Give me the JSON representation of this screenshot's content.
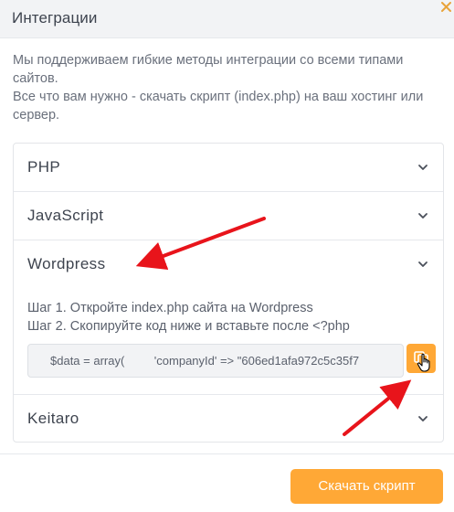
{
  "header": {
    "title": "Интеграции"
  },
  "description": {
    "line1": "Мы поддерживаем гибкие методы интеграции со всеми типами сайтов.",
    "line2": "Все что вам нужно - скачать скрипт (index.php) на ваш хостинг или сервер."
  },
  "accordion": {
    "items": [
      {
        "label": "PHP",
        "expanded": false
      },
      {
        "label": "JavaScript",
        "expanded": false
      },
      {
        "label": "Wordpress",
        "expanded": true,
        "step1": "Шаг 1. Откройте index.php сайта на Wordpress",
        "step2": "Шаг 2. Скопируйте код ниже и вставьте после <?php",
        "code": "$data = array(         'companyId' => \"606ed1afa972c5c35f7"
      },
      {
        "label": "Keitaro",
        "expanded": false
      }
    ]
  },
  "footer": {
    "download_label": "Скачать скрипт"
  },
  "icons": {
    "close": "close-icon",
    "chevron": "chevron-down-icon",
    "copy": "copy-icon",
    "cursor": "hand-cursor-icon"
  },
  "colors": {
    "accent": "#ffa836",
    "annotation_arrow": "#e8141b",
    "close": "#e8a33a"
  }
}
